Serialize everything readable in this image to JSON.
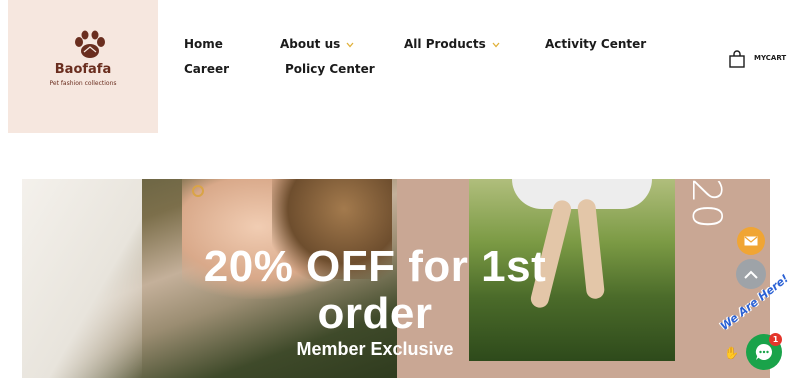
{
  "brand": {
    "name": "Baofafa",
    "tagline": "Pet fashion collections"
  },
  "nav": {
    "items": [
      {
        "label": "Home"
      },
      {
        "label": "About us",
        "has_dropdown": true
      },
      {
        "label": "All Products",
        "has_dropdown": true
      },
      {
        "label": "Activity Center"
      },
      {
        "label": "Career"
      },
      {
        "label": "Policy Center"
      }
    ]
  },
  "cart": {
    "label": "MYCART",
    "icon": "shopping-bag-icon"
  },
  "banner": {
    "title": "20% OFF for 1st order",
    "subtitle": "Member Exclusive",
    "vertical_text": "20"
  },
  "widgets": {
    "mail_icon": "mail-icon",
    "top_icon": "chevron-up-icon",
    "chat_badge": "1",
    "chat_greeting": "We Are Here!"
  },
  "colors": {
    "logo_bg": "#f6e7df",
    "brand_brown": "#6a2e1f",
    "accent_orange": "#f0a534",
    "chat_green": "#1aa34a",
    "chevron_gold": "#e0b13a"
  }
}
